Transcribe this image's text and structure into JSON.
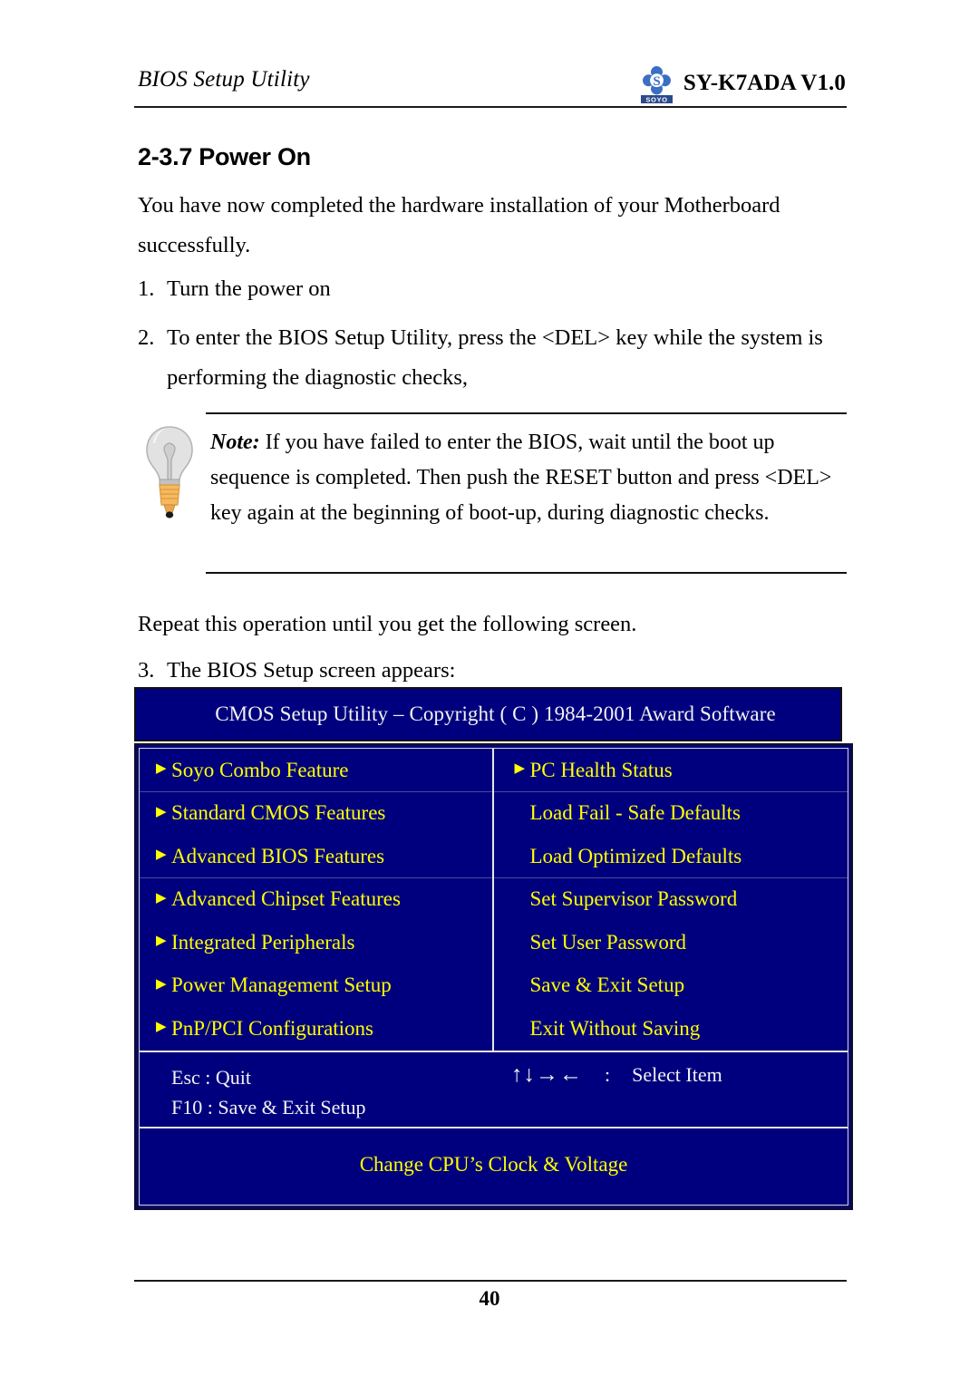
{
  "header": {
    "title": "BIOS Setup Utility",
    "logo_text": "SOYO",
    "model": "SY-K7ADA V1.0"
  },
  "section": {
    "number_title": "2-3.7 Power On"
  },
  "body": {
    "intro": "You have now completed the hardware installation of your Motherboard successfully.",
    "steps": [
      {
        "num": "1.",
        "text": "Turn the power on"
      },
      {
        "num": "2.",
        "text": "To enter the BIOS Setup Utility, press the <DEL> key while the system is performing the diagnostic checks,"
      },
      {
        "num": "3.",
        "text": "The BIOS Setup screen appears:"
      }
    ],
    "repeat_line": "Repeat this operation until you get the following screen."
  },
  "note": {
    "label": "Note:",
    "text": " If you have failed to enter the BIOS, wait until the boot up sequence is completed. Then push the RESET button and press <DEL> key again at the beginning of boot-up, during diagnostic checks.",
    "icon": "lightbulb-icon"
  },
  "bios": {
    "title": "CMOS Setup Utility – Copyright ( C ) 1984-2001 Award Software",
    "left_menu": [
      {
        "label": "Soyo Combo Feature",
        "arrow": true,
        "divider_below": true
      },
      {
        "label": "Standard CMOS Features",
        "arrow": true,
        "divider_below": false
      },
      {
        "label": "Advanced BIOS Features",
        "arrow": true,
        "divider_below": true
      },
      {
        "label": "Advanced Chipset Features",
        "arrow": true,
        "divider_below": false
      },
      {
        "label": "Integrated Peripherals",
        "arrow": true,
        "divider_below": false
      },
      {
        "label": "Power Management Setup",
        "arrow": true,
        "divider_below": false
      },
      {
        "label": "PnP/PCI Configurations",
        "arrow": true,
        "divider_below": false
      }
    ],
    "right_menu": [
      {
        "label": "PC Health Status",
        "arrow": true,
        "divider_below": true
      },
      {
        "label": "Load Fail - Safe Defaults",
        "arrow": false,
        "divider_below": false
      },
      {
        "label": "Load Optimized Defaults",
        "arrow": false,
        "divider_below": true
      },
      {
        "label": "Set Supervisor Password",
        "arrow": false,
        "divider_below": false
      },
      {
        "label": "Set User Password",
        "arrow": false,
        "divider_below": false
      },
      {
        "label": "Save & Exit Setup",
        "arrow": false,
        "divider_below": false
      },
      {
        "label": "Exit Without Saving",
        "arrow": false,
        "divider_below": false
      }
    ],
    "keys": {
      "esc": "Esc : Quit",
      "f10": "F10 : Save & Exit Setup",
      "arrows": "↑↓→←",
      "colon": ":",
      "select": "Select Item"
    },
    "help_bar": "Change CPU’s Clock & Voltage",
    "colors": {
      "screen_bg": "#00007e",
      "menu_text": "#ffff00",
      "key_text": "#f2f2f2",
      "border": "#e6e6e6"
    }
  },
  "footer": {
    "page_number": "40"
  }
}
